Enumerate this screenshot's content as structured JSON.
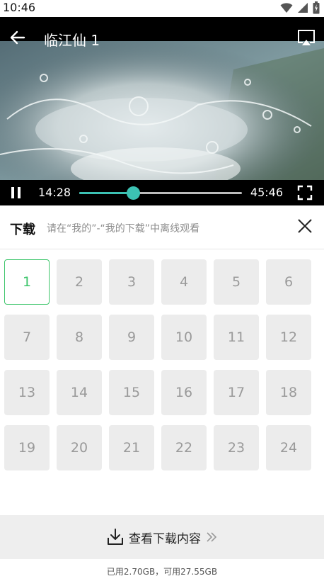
{
  "status_bar": {
    "time": "10:46"
  },
  "player": {
    "title": "临江仙 1",
    "current_time": "14:28",
    "total_time": "45:46",
    "progress": 0.331,
    "accent": "#3cc2b4"
  },
  "download": {
    "title": "下载",
    "hint": "请在“我的”-“我的下载”中离线观看"
  },
  "episodes": {
    "selected": "1",
    "items": [
      "1",
      "2",
      "3",
      "4",
      "5",
      "6",
      "7",
      "8",
      "9",
      "10",
      "11",
      "12",
      "13",
      "14",
      "15",
      "16",
      "17",
      "18",
      "19",
      "20",
      "21",
      "22",
      "23",
      "24"
    ],
    "selected_color": "#3cc56a"
  },
  "footer": {
    "view_downloads": "查看下载内容",
    "storage": "已用2.70GB，可用27.55GB"
  }
}
